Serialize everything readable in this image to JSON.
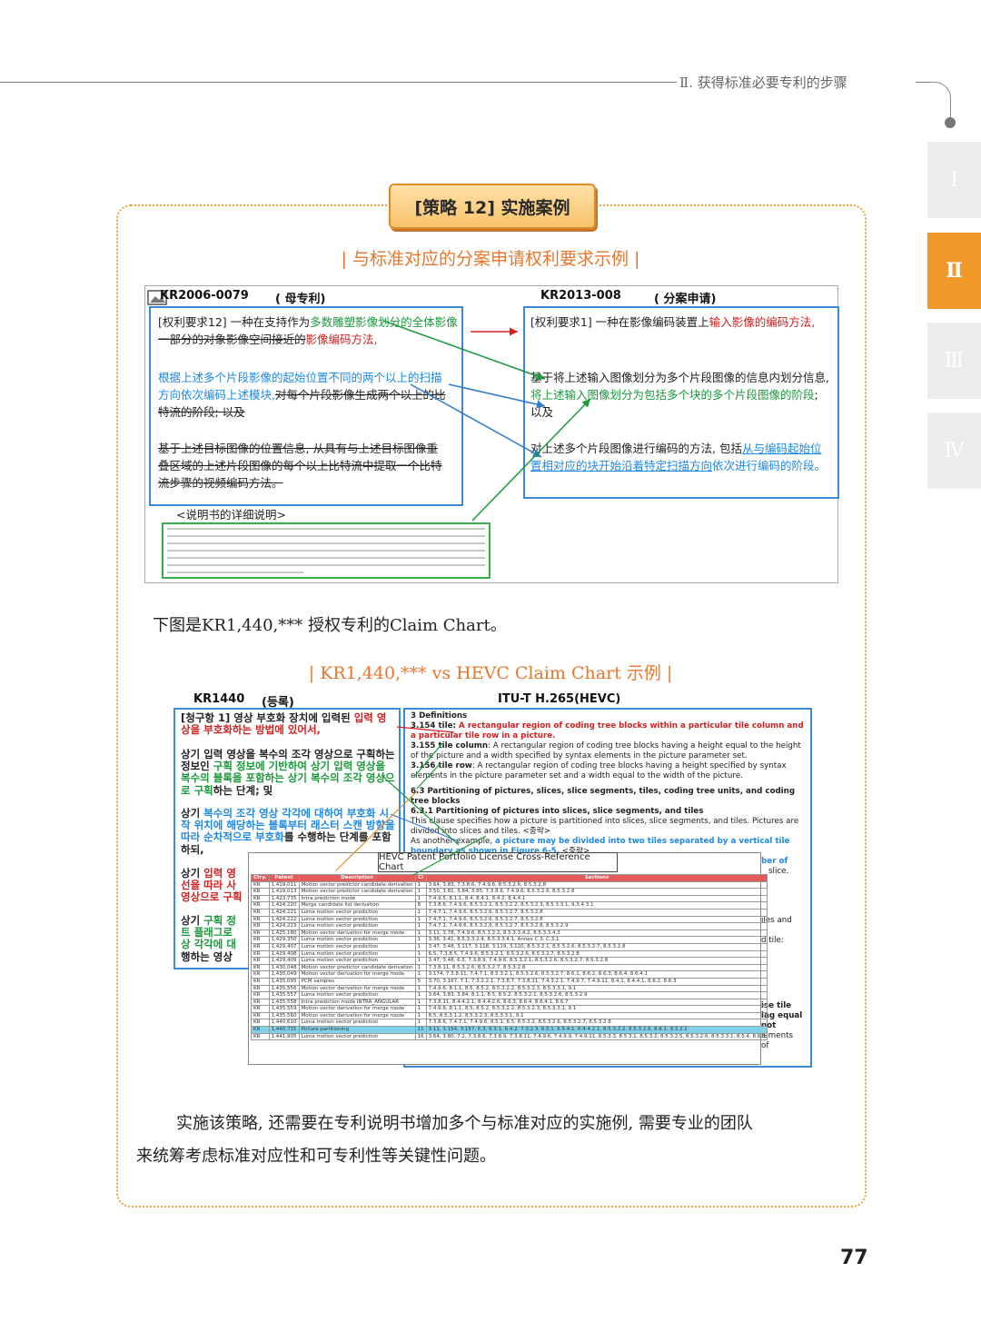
{
  "header": {
    "chapter": "Ⅱ. 获得标准必要专利的步骤"
  },
  "side_tabs": [
    {
      "label": "Ⅰ",
      "active": false
    },
    {
      "label": "Ⅱ",
      "active": true
    },
    {
      "label": "Ⅲ",
      "active": false
    },
    {
      "label": "Ⅳ",
      "active": false
    }
  ],
  "strategy_label": "[策略 12] 实施案例",
  "section1_title": "| 与标准对应的分案申请权利要求示例 |",
  "fig1": {
    "left_id": "KR2006-0079",
    "left_tag": "( 母专利)",
    "right_id": "KR2013-008",
    "right_tag": "( 分案申请)",
    "left_p1_a": "[权利要求12] 一种在支持作为",
    "left_p1_b": "多数雕塑影像划分的全体影像",
    "left_p1_c": "一部分的对象影像空间接近的",
    "left_p1_d": "影像编码方法,",
    "left_p2_a": "根据上述多个片段影像的起始位置不同的两个以上的扫描方向依次编码上述模块,",
    "left_p2_b": "对每个片段影像生成两个以上的比特流的阶段; 以及",
    "left_p3": "基于上述目标图像的位置信息, 从具有与上述目标图像重叠区域的上述片段图像的每个以上比特流中提取一个比特流步骤的视频编码方法。",
    "desc_label": "<说明书的详细说明>",
    "right_p1_a": "[权利要求1]   一种在影像编码装置上",
    "right_p1_b": "输入影像的编码方法,",
    "right_p2_a": "基于将上述输入图像划分为多个片段图像的信息内划分信息,",
    "right_p2_b": "将上述输入图像划分为包括多个块的多个片段图像的阶段",
    "right_p2_c": "; 以及",
    "right_p3_a": "对上述多个片段图像进行编码的方法, 包括",
    "right_p3_b": "从与编码起始位置相对应的块开始沿着特定扫描方向",
    "right_p3_c": "依次进行编码的阶段。"
  },
  "para1": "下图是KR1,440,*** 授权专利的Claim Chart。",
  "section2_title": "| KR1,440,*** vs HEVC Claim Chart 示例 |",
  "fig2": {
    "left_head": "KR1440",
    "left_tag": "(등록)",
    "right_head": "ITU-T H.265(HEVC)",
    "k1_a": "[청구항 1] 영상 부호화 장치에 입력된 ",
    "k1_b": "입력 영상을 부호화하는 방법에 있어서,",
    "k2_a": "상기 입력 영상을 복수의 조각 영상으로 구획하는 정보인 ",
    "k2_b": "구획 정보에 기반하여 상기 입력 영상을 복수의 블록을 포함하는 상기 복수의 조각 영상으로 구획",
    "k2_c": "하는 단계; 및",
    "k3_a": "상기 ",
    "k3_b": "복수의 조각 영상 각각에 대하여 부호화 시작 위치에 해당하는 블록부터 래스터 스캔 방향을 따라 순차적으로 부호화",
    "k3_c": "를 수행하는 단계를 포함하되,",
    "k4_a": "상기 ",
    "k4_b": "입력 영",
    "k4_c": "선을 따라 사",
    "k4_d": "영상으로 구획",
    "k5_a": "상기 ",
    "k5_b": "구획 정",
    "k5_c": "트 플래그로",
    "k5_d": "상 각각에 대",
    "k5_e": "행하는 영상",
    "e1": "3  Definitions",
    "e2_a": "3.154  tile: ",
    "e2_b": "A rectangular region of coding tree blocks within a particular tile column and a particular tile row in a picture.",
    "e3_a": "3.155  tile column",
    "e3_b": ": A rectangular region of coding tree blocks having a height equal to the height of the picture and a width specified by syntax elements in the picture parameter set.",
    "e4_a": "3.156  tile row",
    "e4_b": ": A rectangular region of coding tree blocks having a height specified by syntax elements in the picture parameter set and a width equal to the width of the picture.",
    "e5": "6.3  Partitioning of pictures, slices, slice segments, tiles, coding tree units, and coding tree blocks",
    "e6": "6.3.1  Partitioning of pictures into slices, slice segments, and tiles",
    "e7": "This clause specifies how a picture is partitioned into slices, slice segments, and tiles. Pictures are divided into slices and tiles. <중략>",
    "e8_a": "As another example, ",
    "e8_b": "a picture may be divided into two tiles separated by a vertical tile boundary as shown in Figure 6-5.",
    "e8_c": " <중략>",
    "e9": "always contains an integer number of",
    "e10": "slice.",
    "e11": "iles and",
    "e12": "d tile:",
    "e13": "ise tile",
    "e14": "lag equal",
    "e15": "not",
    "e16": "lements",
    "e17": "of"
  },
  "hevc_chart": {
    "title": "HEVC Patent Portfolio License Cross-Reference Chart",
    "columns": [
      "Ctry.",
      "Patent",
      "Description",
      "Cl",
      "Sections"
    ],
    "rows": [
      [
        "KR",
        "1,419,011",
        "Motion vector predictor candidate derivation",
        "1",
        "3.64, 3.83, 7.3.8.6, 7.4.9.6, 8.5.3.2.6, 8.5.3.2.8"
      ],
      [
        "KR",
        "1,419,013",
        "Motion vector predictor candidate derivation",
        "1",
        "3.50, 3.81, 3.84, 3.85, 7.3.8.6, 7.4.9.6, 8.5.3.2.6, 8.5.3.2.8"
      ],
      [
        "KR",
        "1,423,735",
        "Intra prediction mode",
        "1",
        "7.4.9.5, 8.1.1, 8.4, 8.4.1, 8.4.2, 8.4.4.1"
      ],
      [
        "KR",
        "1,424,220",
        "Merge candidate list derivation",
        "8",
        "7.3.8.6, 7.4.9.6, 8.5.3.2.1, 8.5.3.2.2, 8.5.3.2.3, 8.5.3.3.1, 9.3.4.3.1"
      ],
      [
        "KR",
        "1,424,221",
        "Luma motion vector prediction",
        "1",
        "7.4.7.1, 7.4.9.6, 8.5.3.2.6, 8.5.3.2.7, 8.5.3.2.8"
      ],
      [
        "KR",
        "1,424,222",
        "Luma motion vector prediction",
        "1",
        "7.4.7.1, 7.4.9.6, 8.5.3.2.6, 8.5.3.2.7, 8.5.3.2.8"
      ],
      [
        "KR",
        "1,424,223",
        "Luma motion vector prediction",
        "1",
        "7.4.7.1, 7.4.9.6, 8.5.3.2.6, 8.5.3.2.7, 8.5.3.2.8, 8.5.3.2.9"
      ],
      [
        "KR",
        "1,425,180",
        "Motion vector derivation for merge mode",
        "1",
        "3.11, 3.78, 7.4.9.6, 8.5.3.2.2, 8.5.3.3.4.2, 8.5.3.3.4.3"
      ],
      [
        "KR",
        "1,429,350",
        "Luma motion vector prediction",
        "1",
        "3.36, 3.41, 8.5.3.3.2.4, 8.5.3.3.4.1, Annex C.3, C.3.1"
      ],
      [
        "KR",
        "1,429,407",
        "Luma motion vector prediction",
        "1",
        "3.47, 3.48, 3.117, 3.118, 3.119, 3.120, 8.5.3.2.1, 8.5.3.2.6, 8.5.3.2.7, 8.5.3.2.8"
      ],
      [
        "KR",
        "1,429,408",
        "Luma motion vector prediction",
        "1",
        "6.5, 7.3.8.5, 7.4.9.6, 8.5.3.2.1, 8.5.3.2.6, 8.5.3.2.7, 8.5.3.2.8"
      ],
      [
        "KR",
        "1,429,409",
        "Luma motion vector prediction",
        "1",
        "3.47, 3.48, 6.5, 7.3.8.9, 7.4.9.6, 8.5.3.2.1, 8.5.3.2.6, 8.5.3.2.7, 8.5.3.2.8"
      ],
      [
        "KR",
        "1,430,048",
        "Motion vector predictor candidate derivation",
        "1",
        "7.3.8.11, 8.5.3.2.6, 8.5.3.2.7, 8.5.3.2.8"
      ],
      [
        "KR",
        "1,430,049",
        "Motion vector derivation for merge mode",
        "1",
        "3.174, 7.3.8.11, 7.4.7.1, 8.5.3.2.1, 8.5.3.2.6, 8.5.3.2.7, 8.6.1, 8.6.2, 8.6.3, 8.6.4, 8.6.4.1"
      ],
      [
        "KR",
        "1,435,095",
        "PCM samples",
        "5",
        "3.70, 3.167, 7.1, 7.3.2.2.1, 7.3.8.7, 7.3.8.11, 7.4.3.2.1, 7.4.9.7, 7.4.9.11, 8.4.1, 8.4.4.1, 8.6.2, 8.6.3"
      ],
      [
        "KR",
        "1,435,556",
        "Motion vector derivation for merge mode",
        "1",
        "7.4.9.6, 8.1.1, 8.5, 8.5.2, 8.5.3.2.2, 8.5.3.2.3, 8.5.3.3.1, 9.1"
      ],
      [
        "KR",
        "1,435,557",
        "Luma motion vector prediction",
        "1",
        "3.64, 3.83, 3.84, 8.1.1, 8.5, 8.5.2, 8.5.3.2.1, 8.5.3.2.6, 8.5.3.2.9"
      ],
      [
        "KR",
        "1,435,558",
        "Intra prediction mode INTRA_ANGULAR",
        "1",
        "7.3.8.11, 8.4.4.2.1, 8.4.4.2.6, 8.6.3, 8.6.4, 8.6.4.1, 8.6.7"
      ],
      [
        "KR",
        "1,435,559",
        "Motion vector derivation for merge mode",
        "1",
        "7.4.9.6, 8.1.1, 8.5, 8.5.2, 8.5.3.2.2, 8.5.3.2.3, 8.5.3.3.1, 9.1"
      ],
      [
        "KR",
        "1,435,560",
        "Motion vector derivation for merge mode",
        "1",
        "8.5, 8.5.3.1.2, 8.5.3.2.3, 8.5.3.3.1, 9.1"
      ],
      [
        "KR",
        "1,440,610",
        "Luma motion vector prediction",
        "1",
        "7.3.8.6, 7.4.7.1, 7.4.9.6, 8.5.1, 8.5, 8.5.3.2, 8.5.3.2.6, 8.5.3.2.7, 8.5.3.2.8"
      ],
      [
        "KR",
        "1,440,731",
        "Picture partitioning",
        "11",
        "3.11, 3.154, 3.157, 6.3, 6.3.1, 6.4.2, 7.3.2.3, 6.5.1, 6.5.4.1, 6.4.4.2.1, 8.5.3.2.2, 8.5.3.2.6, 8.6.1, 9.3.2.1"
      ],
      [
        "KR",
        "1,441,905",
        "Luma motion vector prediction",
        "16",
        "3.64, 3.80, 7.2, 7.3.8.6, 7.3.8.9, 7.3.8.11, 7.4.9.6, 7.4.9.9, 7.4.9.11, 8.5.3.3, 8.5.3.1, 8.5.3.2, 8.5.3.2.5, 8.5.3.2.6, 8.5.3.3.1, 8.5.4, 8.6.3"
      ]
    ],
    "highlight_row": 21
  },
  "para2_line1": "实施该策略, 还需要在专利说明书增加多个与标准对应的实施例, 需要专业的团队",
  "para2_line2": "来统筹考虑标准对应性和可专利性等关键性问题。",
  "page_number": "77",
  "colors": {
    "accent": "#f19a2a",
    "title_orange": "#e8762c",
    "claim_blue": "#1e88e5",
    "claim_red": "#d32020",
    "claim_green": "#1a9a3a"
  }
}
